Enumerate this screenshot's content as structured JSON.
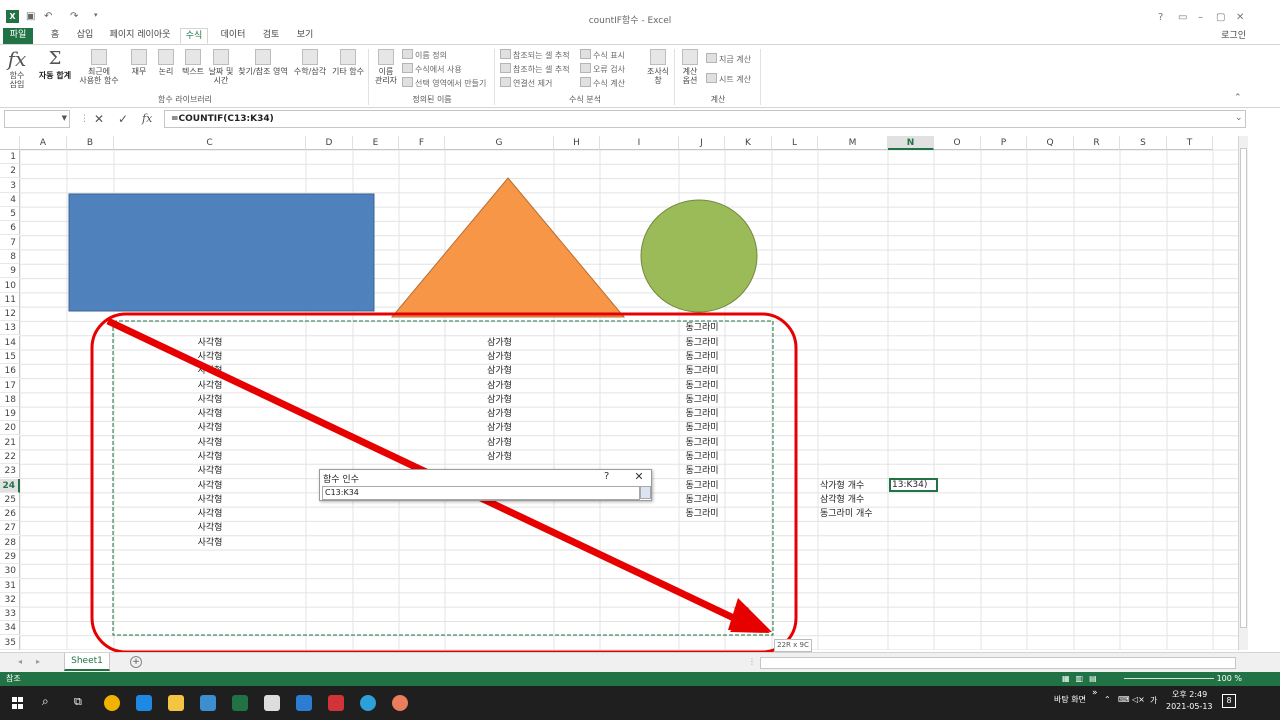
{
  "window": {
    "title": "countIF함수 - Excel",
    "app_icon": "X",
    "quick_access": [
      "save-icon",
      "undo-icon",
      "redo-icon"
    ],
    "controls": [
      "help-icon",
      "restore-ribbon-icon",
      "minimize-icon",
      "maximize-icon",
      "close-icon"
    ],
    "login": "로그인"
  },
  "ribbon": {
    "tabs": [
      "파일",
      "홈",
      "삽입",
      "페이지 레이아웃",
      "수식",
      "데이터",
      "검토",
      "보기"
    ],
    "active_tab": "수식",
    "library": {
      "insert_function": "함수\n삽입",
      "autosum": "자동 합계",
      "recent": "최근에\n사용한 함수",
      "finance": "재무",
      "logic": "논리",
      "text": "텍스트",
      "datetime": "날짜 및\n시간",
      "lookup": "찾기/참조 영역",
      "math": "수학/삼각",
      "more": "기타 함수",
      "group": "함수 라이브러리"
    },
    "names": {
      "manager": "이름\n관리자",
      "define": "이름 정의",
      "use_in_formula": "수식에서 사용",
      "create_from_selection": "선택 영역에서 만들기",
      "group": "정의된 이름"
    },
    "audit": {
      "trace_precedents": "참조되는 셀 추적",
      "trace_dependents": "참조하는 셀 추적",
      "remove_arrows": "연결선 제거",
      "show_formulas": "수식 표시",
      "error_checking": "오류 검사",
      "evaluate": "수식 계산",
      "watch": "조사식\n창",
      "group": "수식 분석"
    },
    "calc": {
      "options": "계산\n옵션",
      "calc_now": "지금 계산",
      "calc_sheet": "시트 계산",
      "group": "계산"
    }
  },
  "formula_bar": {
    "name_box": "",
    "cancel_icon": "✕",
    "enter_icon": "✓",
    "fx": "fx",
    "formula": "=COUNTIF(C13:K34)"
  },
  "columns": [
    "A",
    "B",
    "C",
    "D",
    "E",
    "F",
    "G",
    "H",
    "I",
    "J",
    "K",
    "L",
    "M",
    "N",
    "O",
    "P",
    "Q",
    "R",
    "S",
    "T"
  ],
  "selected_column": "N",
  "rows": [
    "1",
    "2",
    "3",
    "4",
    "5",
    "6",
    "7",
    "8",
    "9",
    "10",
    "11",
    "12",
    "13",
    "14",
    "15",
    "16",
    "17",
    "18",
    "19",
    "20",
    "21",
    "22",
    "23",
    "24",
    "25",
    "26",
    "27",
    "28",
    "29",
    "30",
    "31",
    "32",
    "33",
    "34",
    "35"
  ],
  "selected_row": "24",
  "sheet": {
    "col_c": [
      "사각형",
      "사각형",
      "사각형",
      "사각형",
      "사각형",
      "사각형",
      "사각형",
      "사각형",
      "사각형",
      "사각형",
      "사각형",
      "사각형",
      "사각형",
      "사각형",
      "사각형"
    ],
    "col_g": [
      "삼가형",
      "삼가형",
      "삼가형",
      "삼가형",
      "삼가형",
      "삼가형",
      "삼가형",
      "삼가형",
      "삼가형"
    ],
    "col_j": [
      "동그라미",
      "동그라미",
      "동그라미",
      "동그라미",
      "동그라미",
      "동그라미",
      "동그라미",
      "동그라미",
      "동그라미",
      "동그라미",
      "동그라미",
      "동그라미",
      "동그라미",
      "동그라미"
    ],
    "labels_m": [
      "삭가형 개수",
      "삼각형 개수",
      "동그라미 개수"
    ],
    "active_cell_value": "13:K34)"
  },
  "shapes": {
    "rectangle_color": "#4f81bd",
    "triangle_color": "#f79646",
    "circle_color": "#9bbb59",
    "highlight_color": "#e60000",
    "selection_color": "#217346"
  },
  "dialog": {
    "title": "함수 인수",
    "help": "?",
    "close": "✕",
    "input": "C13:K34"
  },
  "size_tip": "22R x 9C",
  "sheet_tabs": {
    "active": "Sheet1",
    "add": "+"
  },
  "status": {
    "mode": "참조",
    "zoom": "100 %"
  },
  "taskbar": {
    "apps": [
      "chrome-icon",
      "edge-icon",
      "file-explorer-icon",
      "app-icon",
      "excel-icon",
      "store-icon",
      "mail-icon",
      "app2-icon",
      "edge-new-icon",
      "paint-icon"
    ],
    "desktop": "바탕 화면",
    "ime": "가",
    "time": "오후 2:49",
    "date": "2021-05-13",
    "notifications": "8"
  }
}
